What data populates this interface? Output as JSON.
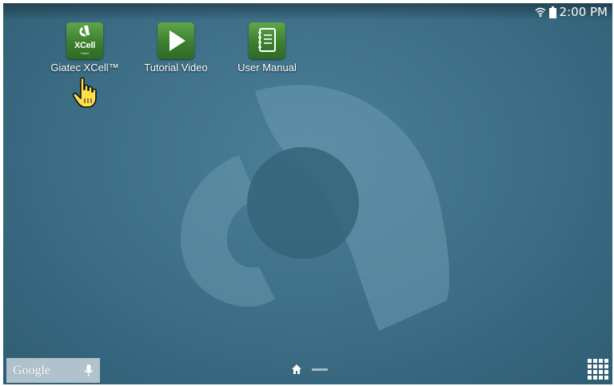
{
  "status_bar": {
    "time": "2:00 PM",
    "icons": [
      "wifi-icon",
      "battery-icon"
    ]
  },
  "home_screen": {
    "apps": [
      {
        "label": "Giatec XCell™",
        "icon": "xcell-app-icon",
        "tile_text": "XCell",
        "tile_subtext": "Tablet"
      },
      {
        "label": "Tutorial Video",
        "icon": "play-icon"
      },
      {
        "label": "User Manual",
        "icon": "notebook-icon"
      }
    ]
  },
  "search_widget": {
    "label": "Google",
    "icon": "mic-icon"
  },
  "navigation": {
    "home_page_icon": "home-icon",
    "apps_button_icon": "apps-grid-icon"
  },
  "colors": {
    "wallpaper": "#3e7189",
    "app_tile": "#3c7e2f",
    "text": "#ffffff"
  }
}
